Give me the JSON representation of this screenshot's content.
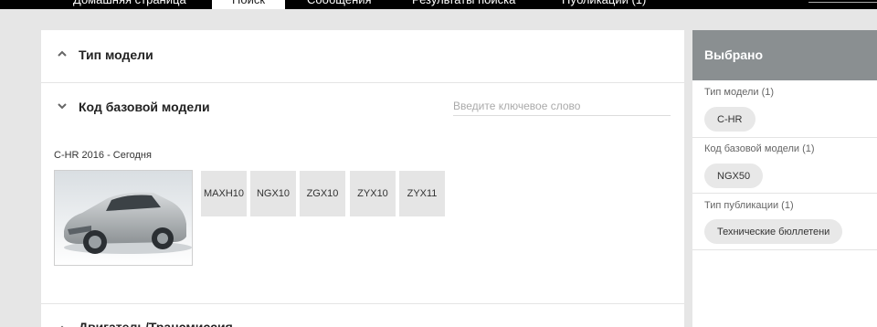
{
  "nav": {
    "tabs": [
      {
        "label": "Домашняя страница"
      },
      {
        "label": "Поиск"
      },
      {
        "label": "Сообщения"
      },
      {
        "label": "Результаты поиска"
      },
      {
        "label": "Публикации (1)"
      }
    ]
  },
  "filters": {
    "model_type_title": "Тип модели",
    "base_model_code_title": "Код базовой модели",
    "keyword_placeholder": "Введите ключевое слово",
    "model_range": "C-HR 2016 - Сегодня",
    "codes": [
      "MAXH10",
      "NGX10",
      "ZGX10",
      "ZYX10",
      "ZYX11"
    ],
    "engine_title": "Двигатель/Трансмиссия"
  },
  "selected": {
    "title": "Выбрано",
    "groups": [
      {
        "label": "Тип модели (1)",
        "chip": "C-HR"
      },
      {
        "label": "Код базовой модели (1)",
        "chip": "NGX50"
      },
      {
        "label": "Тип публикации (1)",
        "chip": "Технические бюллетени"
      }
    ]
  },
  "colors": {
    "topbar": "#000000",
    "panel_header": "#8a8f91",
    "chip_bg": "#e8e8e8",
    "code_bg": "#e5e5e5"
  }
}
